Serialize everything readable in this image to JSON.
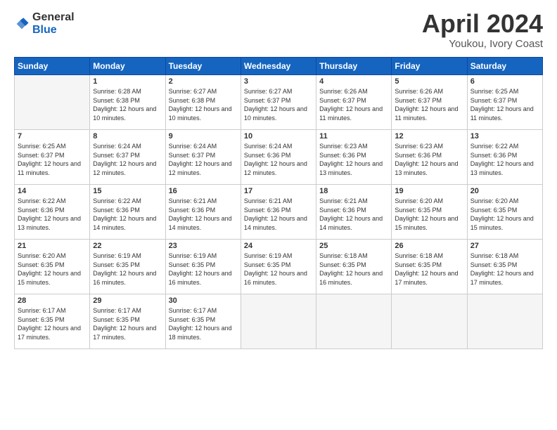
{
  "logo": {
    "general": "General",
    "blue": "Blue"
  },
  "header": {
    "title": "April 2024",
    "subtitle": "Youkou, Ivory Coast"
  },
  "days_of_week": [
    "Sunday",
    "Monday",
    "Tuesday",
    "Wednesday",
    "Thursday",
    "Friday",
    "Saturday"
  ],
  "weeks": [
    [
      {
        "day": "",
        "info": ""
      },
      {
        "day": "1",
        "info": "Sunrise: 6:28 AM\nSunset: 6:38 PM\nDaylight: 12 hours\nand 10 minutes."
      },
      {
        "day": "2",
        "info": "Sunrise: 6:27 AM\nSunset: 6:38 PM\nDaylight: 12 hours\nand 10 minutes."
      },
      {
        "day": "3",
        "info": "Sunrise: 6:27 AM\nSunset: 6:37 PM\nDaylight: 12 hours\nand 10 minutes."
      },
      {
        "day": "4",
        "info": "Sunrise: 6:26 AM\nSunset: 6:37 PM\nDaylight: 12 hours\nand 11 minutes."
      },
      {
        "day": "5",
        "info": "Sunrise: 6:26 AM\nSunset: 6:37 PM\nDaylight: 12 hours\nand 11 minutes."
      },
      {
        "day": "6",
        "info": "Sunrise: 6:25 AM\nSunset: 6:37 PM\nDaylight: 12 hours\nand 11 minutes."
      }
    ],
    [
      {
        "day": "7",
        "info": "Sunrise: 6:25 AM\nSunset: 6:37 PM\nDaylight: 12 hours\nand 11 minutes."
      },
      {
        "day": "8",
        "info": "Sunrise: 6:24 AM\nSunset: 6:37 PM\nDaylight: 12 hours\nand 12 minutes."
      },
      {
        "day": "9",
        "info": "Sunrise: 6:24 AM\nSunset: 6:37 PM\nDaylight: 12 hours\nand 12 minutes."
      },
      {
        "day": "10",
        "info": "Sunrise: 6:24 AM\nSunset: 6:36 PM\nDaylight: 12 hours\nand 12 minutes."
      },
      {
        "day": "11",
        "info": "Sunrise: 6:23 AM\nSunset: 6:36 PM\nDaylight: 12 hours\nand 13 minutes."
      },
      {
        "day": "12",
        "info": "Sunrise: 6:23 AM\nSunset: 6:36 PM\nDaylight: 12 hours\nand 13 minutes."
      },
      {
        "day": "13",
        "info": "Sunrise: 6:22 AM\nSunset: 6:36 PM\nDaylight: 12 hours\nand 13 minutes."
      }
    ],
    [
      {
        "day": "14",
        "info": "Sunrise: 6:22 AM\nSunset: 6:36 PM\nDaylight: 12 hours\nand 13 minutes."
      },
      {
        "day": "15",
        "info": "Sunrise: 6:22 AM\nSunset: 6:36 PM\nDaylight: 12 hours\nand 14 minutes."
      },
      {
        "day": "16",
        "info": "Sunrise: 6:21 AM\nSunset: 6:36 PM\nDaylight: 12 hours\nand 14 minutes."
      },
      {
        "day": "17",
        "info": "Sunrise: 6:21 AM\nSunset: 6:36 PM\nDaylight: 12 hours\nand 14 minutes."
      },
      {
        "day": "18",
        "info": "Sunrise: 6:21 AM\nSunset: 6:36 PM\nDaylight: 12 hours\nand 14 minutes."
      },
      {
        "day": "19",
        "info": "Sunrise: 6:20 AM\nSunset: 6:35 PM\nDaylight: 12 hours\nand 15 minutes."
      },
      {
        "day": "20",
        "info": "Sunrise: 6:20 AM\nSunset: 6:35 PM\nDaylight: 12 hours\nand 15 minutes."
      }
    ],
    [
      {
        "day": "21",
        "info": "Sunrise: 6:20 AM\nSunset: 6:35 PM\nDaylight: 12 hours\nand 15 minutes."
      },
      {
        "day": "22",
        "info": "Sunrise: 6:19 AM\nSunset: 6:35 PM\nDaylight: 12 hours\nand 16 minutes."
      },
      {
        "day": "23",
        "info": "Sunrise: 6:19 AM\nSunset: 6:35 PM\nDaylight: 12 hours\nand 16 minutes."
      },
      {
        "day": "24",
        "info": "Sunrise: 6:19 AM\nSunset: 6:35 PM\nDaylight: 12 hours\nand 16 minutes."
      },
      {
        "day": "25",
        "info": "Sunrise: 6:18 AM\nSunset: 6:35 PM\nDaylight: 12 hours\nand 16 minutes."
      },
      {
        "day": "26",
        "info": "Sunrise: 6:18 AM\nSunset: 6:35 PM\nDaylight: 12 hours\nand 17 minutes."
      },
      {
        "day": "27",
        "info": "Sunrise: 6:18 AM\nSunset: 6:35 PM\nDaylight: 12 hours\nand 17 minutes."
      }
    ],
    [
      {
        "day": "28",
        "info": "Sunrise: 6:17 AM\nSunset: 6:35 PM\nDaylight: 12 hours\nand 17 minutes."
      },
      {
        "day": "29",
        "info": "Sunrise: 6:17 AM\nSunset: 6:35 PM\nDaylight: 12 hours\nand 17 minutes."
      },
      {
        "day": "30",
        "info": "Sunrise: 6:17 AM\nSunset: 6:35 PM\nDaylight: 12 hours\nand 18 minutes."
      },
      {
        "day": "",
        "info": ""
      },
      {
        "day": "",
        "info": ""
      },
      {
        "day": "",
        "info": ""
      },
      {
        "day": "",
        "info": ""
      }
    ]
  ]
}
